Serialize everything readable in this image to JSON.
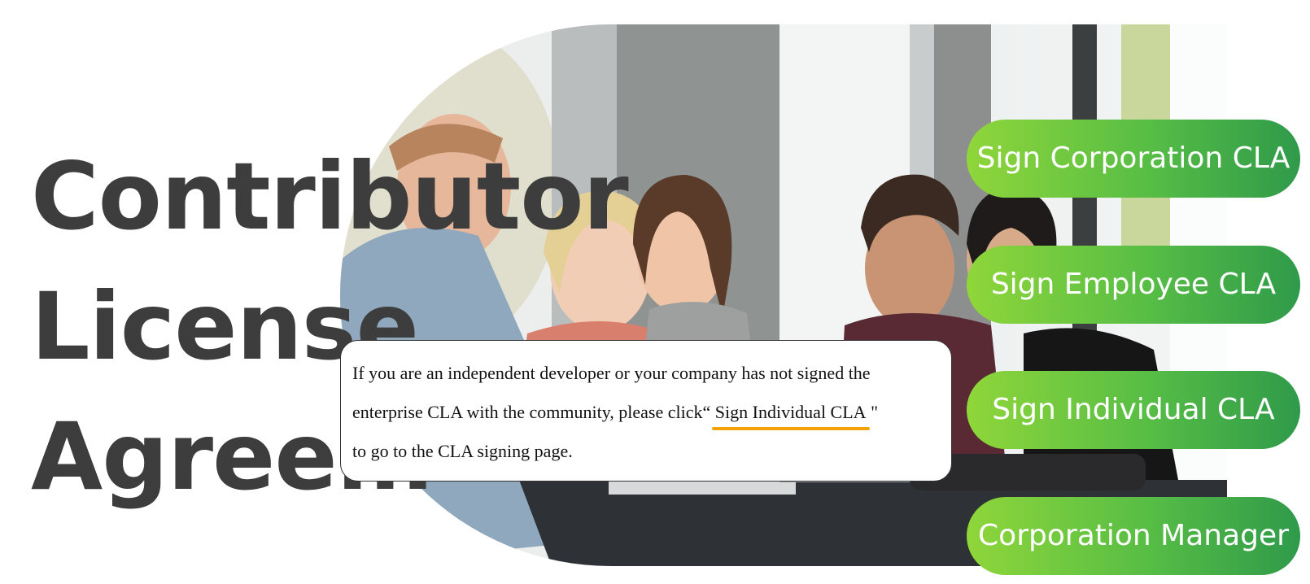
{
  "title": {
    "lines": [
      {
        "cap": "C",
        "rest": "ontributor"
      },
      {
        "cap": "L",
        "rest": "icense"
      },
      {
        "cap": "A",
        "rest": "greem"
      }
    ]
  },
  "callout": {
    "text_line1": "If you are an independent developer or your company has not signed the",
    "text_line2_before": "enterprise CLA with the community, please click“ ",
    "link_label": "Sign Individual CLA",
    "text_line2_after": " \"",
    "text_line3": "to go to the CLA signing page."
  },
  "buttons": {
    "corporation": "Sign Corporation CLA",
    "employee": "Sign Employee CLA",
    "individual": "Sign Individual CLA",
    "manager": "Corporation Manager"
  },
  "colors": {
    "title_text": "#3d3d3d",
    "button_gradient_start": "#8fd63a",
    "button_gradient_end": "#2f9a4a",
    "link_underline": "#f2a20a"
  }
}
